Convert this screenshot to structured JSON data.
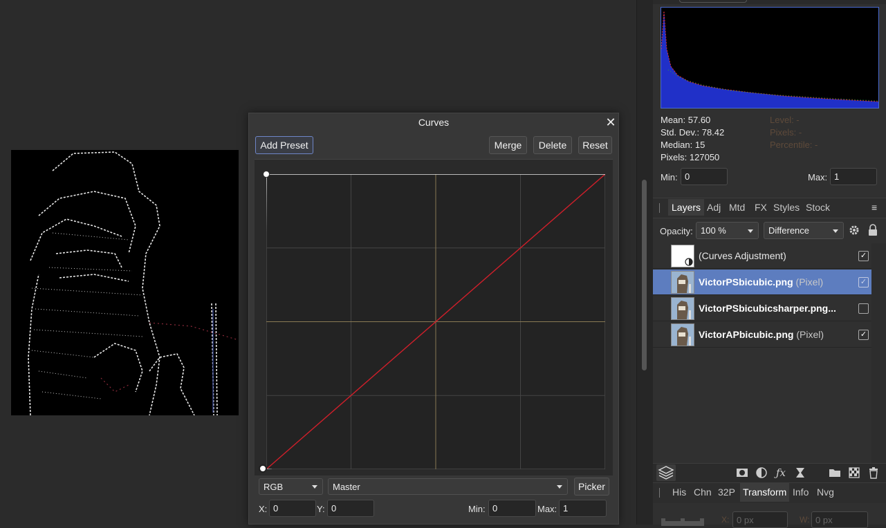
{
  "histogram": {
    "stats": {
      "mean": "Mean: 57.60",
      "std_dev": "Std. Dev.: 78.42",
      "median": "Median: 15",
      "pixels": "Pixels: 127050",
      "level": "Level: -",
      "pixels_cursor": "Pixels: -",
      "percentile": "Percentile: -"
    },
    "min_label": "Min:",
    "min_value": "0",
    "max_label": "Max:",
    "max_value": "1"
  },
  "layers_panel": {
    "tabs": [
      "Layers",
      "Adj",
      "Mtd",
      "FX",
      "Styles",
      "Stock"
    ],
    "active_tab": "Layers",
    "opacity_label": "Opacity:",
    "opacity_value": "100 %",
    "blend_mode": "Difference",
    "layers": [
      {
        "name": "(Curves Adjustment)",
        "kind": "",
        "checked": true,
        "selected": false
      },
      {
        "name": "VictorPSbicubic.png",
        "kind": "(Pixel)",
        "checked": true,
        "selected": true
      },
      {
        "name": "VictorPSbicubicsharper.png...",
        "kind": "",
        "checked": false,
        "selected": false
      },
      {
        "name": "VictorAPbicubic.png",
        "kind": "(Pixel)",
        "checked": true,
        "selected": false
      }
    ],
    "check_glyph": "✓"
  },
  "bottom_panel": {
    "tabs": [
      "His",
      "Chn",
      "32P",
      "Transform",
      "Info",
      "Nvg"
    ],
    "active_tab": "Transform",
    "x_label": "X:",
    "x_value": "0 px",
    "w_label": "W:",
    "w_value": "0 px"
  },
  "curves_dialog": {
    "title": "Curves",
    "close_glyph": "✕",
    "add_preset": "Add Preset",
    "merge": "Merge",
    "delete": "Delete",
    "reset": "Reset",
    "channel": "RGB",
    "component": "Master",
    "picker": "Picker",
    "x_label": "X:",
    "x_value": "0",
    "y_label": "Y:",
    "y_value": "0",
    "min_label": "Min:",
    "min_value": "0",
    "max_label": "Max:",
    "max_value": "1"
  },
  "colors": {
    "canvas_bg": "#2b2b2b",
    "panel_bg": "#303030",
    "selected_layer": "#5d7dbf",
    "curve_red": "#d01f2a",
    "grid_tan": "#8a7a55"
  }
}
